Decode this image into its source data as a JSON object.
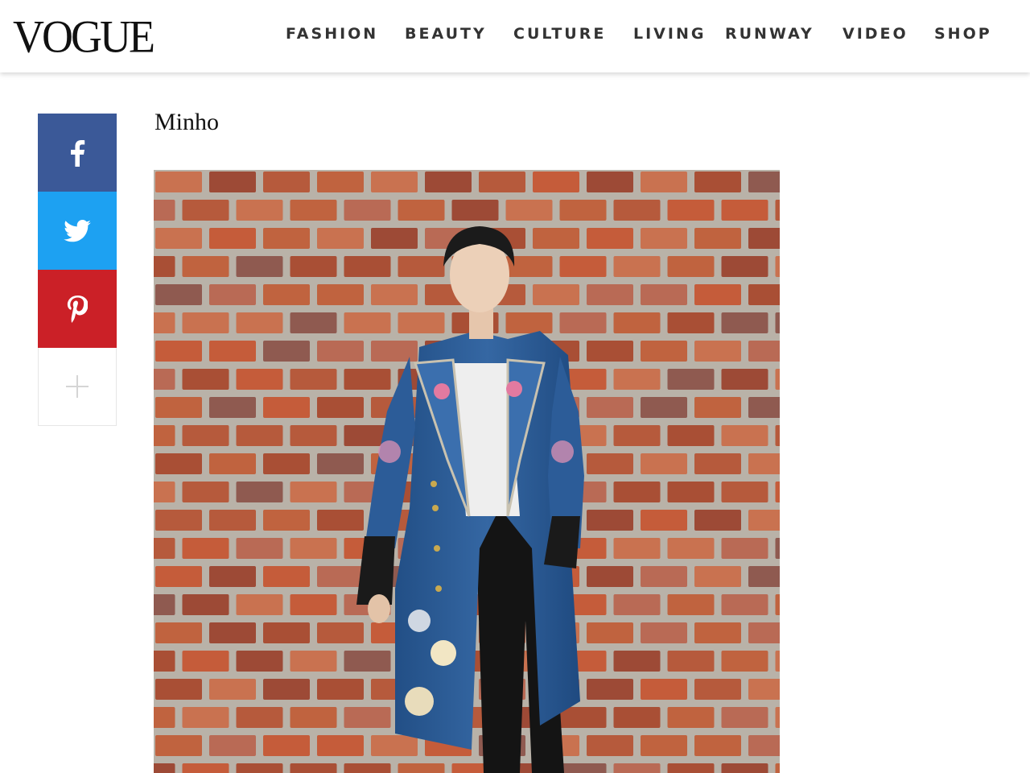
{
  "brand": {
    "logo_text": "VOGUE"
  },
  "nav": {
    "items": [
      {
        "label": "FASHION"
      },
      {
        "label": "BEAUTY"
      },
      {
        "label": "CULTURE"
      },
      {
        "label": "LIVING"
      },
      {
        "label": "RUNWAY"
      },
      {
        "label": "VIDEO"
      },
      {
        "label": "SHOP"
      }
    ]
  },
  "share": {
    "buttons": [
      {
        "icon": "facebook-icon",
        "color": "#3b5998"
      },
      {
        "icon": "twitter-icon",
        "color": "#1da1f2"
      },
      {
        "icon": "pinterest-icon",
        "color": "#cb2027"
      },
      {
        "icon": "plus-icon",
        "color": "#ffffff"
      }
    ]
  },
  "slide": {
    "caption_title": "Minho",
    "photo_subject": "man in embroidered blue long coat in front of brick wall"
  },
  "colors": {
    "header_bg": "#ffffff",
    "text": "#111111",
    "brick": "#b65a3c",
    "mortar": "#b9b2a8",
    "coat": "#2b5f9b"
  }
}
